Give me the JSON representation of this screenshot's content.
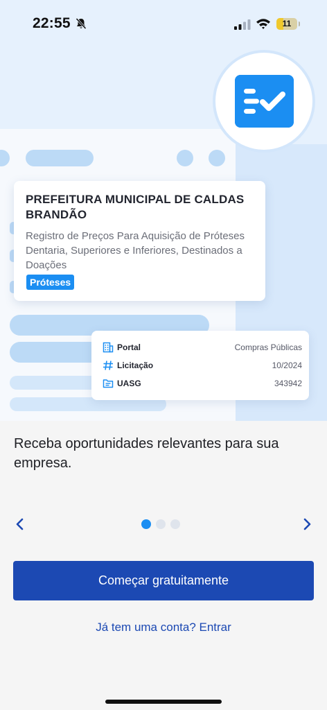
{
  "status_bar": {
    "time": "22:55",
    "battery_level": "11",
    "icons": [
      "bell-slash-icon",
      "cellular-signal-icon",
      "wifi-icon",
      "battery-icon"
    ]
  },
  "illustration": {
    "org_title": "PREFEITURA MUNICIPAL DE CALDAS BRANDÃO",
    "description": "Registro de Preços Para Aquisição de Próteses Dentaria, Superiores e Inferiores, Destinados a Doações",
    "tag": "Próteses",
    "check_icon": "checklist-icon",
    "info_rows": [
      {
        "icon": "building-icon",
        "label": "Portal",
        "value": "Compras Públicas"
      },
      {
        "icon": "hash-icon",
        "label": "Licitação",
        "value": "10/2024"
      },
      {
        "icon": "folder-icon",
        "label": "UASG",
        "value": "343942"
      }
    ]
  },
  "onboarding": {
    "headline": "Receba oportunidades relevantes para sua empresa.",
    "current_page": 1,
    "total_pages": 3,
    "prev_icon": "chevron-left-icon",
    "next_icon": "chevron-right-icon"
  },
  "actions": {
    "primary_button": "Começar gratuitamente",
    "login_link": "Já tem uma conta? Entrar"
  },
  "colors": {
    "accent_blue": "#1b8ef2",
    "primary_button": "#1c49b3",
    "hero_background": "#e6f1fd",
    "page_background": "#f5f5f5"
  }
}
